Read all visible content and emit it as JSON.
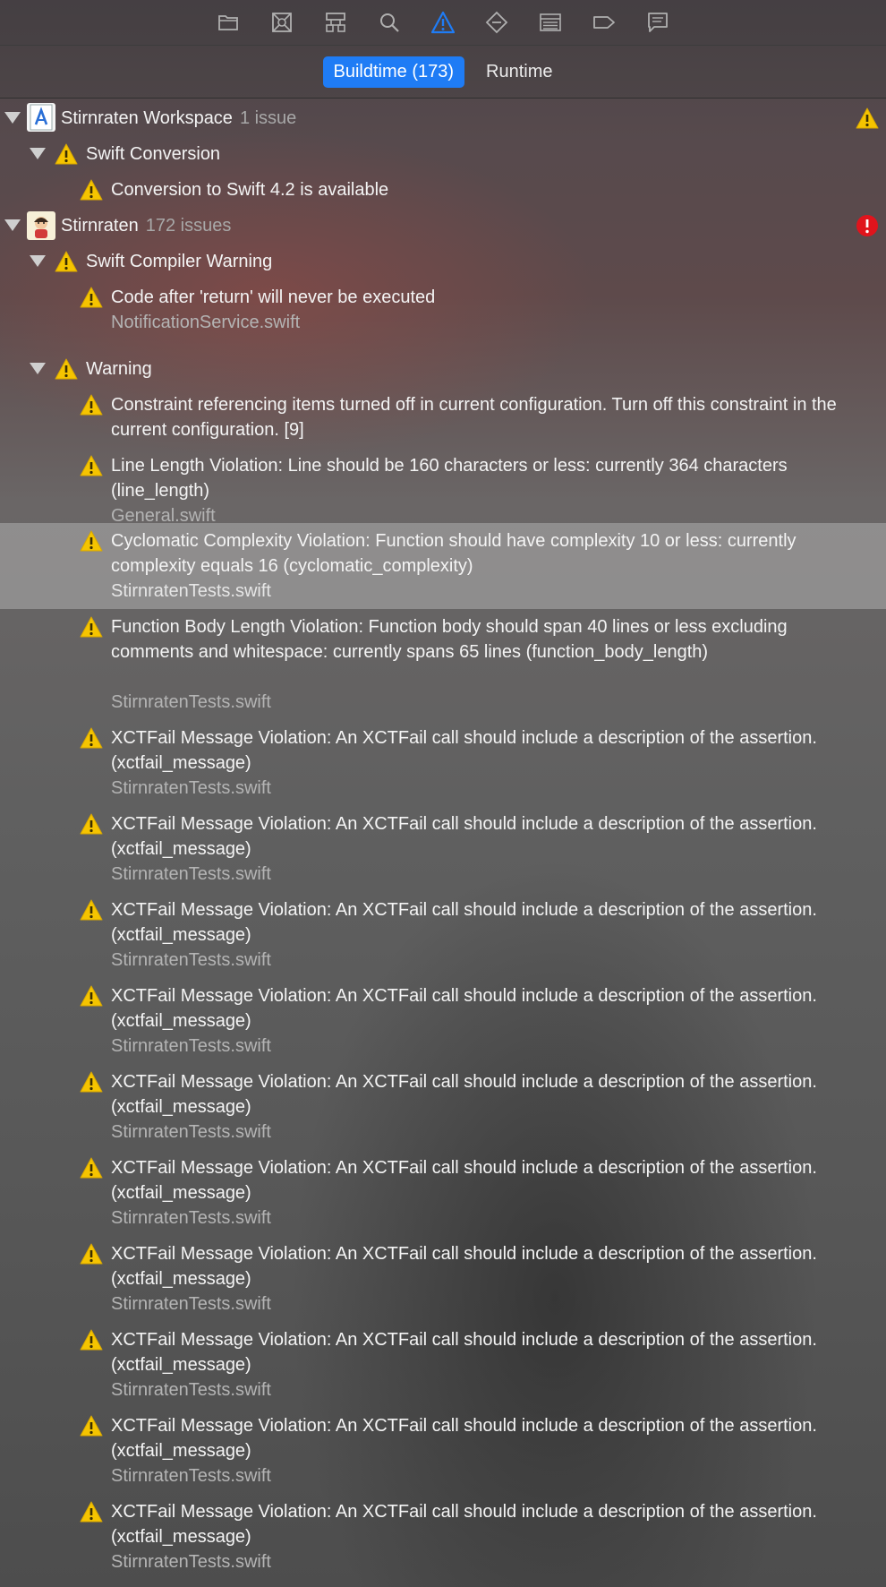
{
  "toolbar": {
    "icons": [
      "folder-icon",
      "source-control-icon",
      "hierarchy-icon",
      "search-icon",
      "warning-icon",
      "breakpoint-icon",
      "list-icon",
      "tag-icon",
      "comment-icon"
    ],
    "active_icon": "warning-icon",
    "accent_color": "#1f7cf5"
  },
  "scope": {
    "buildtime_label": "Buildtime (173)",
    "runtime_label": "Runtime",
    "selected": "Buildtime (173)"
  },
  "tree": {
    "workspace": {
      "name": "Stirnraten Workspace",
      "count": "1 issue"
    },
    "swift_conversion": {
      "label": "Swift Conversion"
    },
    "conversion_issue": {
      "message": "Conversion to Swift 4.2 is available"
    },
    "project": {
      "name": "Stirnraten",
      "count": "172 issues"
    },
    "compiler_warning": {
      "label": "Swift Compiler Warning"
    },
    "return_issue": {
      "message": "Code after 'return' will never be executed",
      "file": "NotificationService.swift"
    },
    "warning_group": {
      "label": "Warning"
    },
    "issues": [
      {
        "message": "Constraint referencing items turned off in current configuration. Turn off this constraint in the current configuration. [9]",
        "file": ""
      },
      {
        "message": "Line Length Violation: Line should be 160 characters or less: currently 364 characters (line_length)",
        "file": "General.swift"
      },
      {
        "message": "Cyclomatic Complexity Violation: Function should have complexity 10 or less: currently complexity equals 16 (cyclomatic_complexity)",
        "file": "StirnratenTests.swift",
        "selected": true
      },
      {
        "message": "Function Body Length Violation: Function body should span 40 lines or less excluding comments and whitespace: currently spans 65 lines (function_body_length)",
        "file": "StirnratenTests.swift"
      },
      {
        "message": "XCTFail Message Violation: An XCTFail call should include a description of the assertion. (xctfail_message)",
        "file": "StirnratenTests.swift"
      },
      {
        "message": "XCTFail Message Violation: An XCTFail call should include a description of the assertion. (xctfail_message)",
        "file": "StirnratenTests.swift"
      },
      {
        "message": "XCTFail Message Violation: An XCTFail call should include a description of the assertion. (xctfail_message)",
        "file": "StirnratenTests.swift"
      },
      {
        "message": "XCTFail Message Violation: An XCTFail call should include a description of the assertion. (xctfail_message)",
        "file": "StirnratenTests.swift"
      },
      {
        "message": "XCTFail Message Violation: An XCTFail call should include a description of the assertion. (xctfail_message)",
        "file": "StirnratenTests.swift"
      },
      {
        "message": "XCTFail Message Violation: An XCTFail call should include a description of the assertion. (xctfail_message)",
        "file": "StirnratenTests.swift"
      },
      {
        "message": "XCTFail Message Violation: An XCTFail call should include a description of the assertion. (xctfail_message)",
        "file": "StirnratenTests.swift"
      },
      {
        "message": "XCTFail Message Violation: An XCTFail call should include a description of the assertion. (xctfail_message)",
        "file": "StirnratenTests.swift"
      },
      {
        "message": "XCTFail Message Violation: An XCTFail call should include a description of the assertion. (xctfail_message)",
        "file": "StirnratenTests.swift"
      },
      {
        "message": "XCTFail Message Violation: An XCTFail call should include a description of the assertion. (xctfail_message)",
        "file": "StirnratenTests.swift"
      }
    ]
  },
  "colors": {
    "warning": "#f5c400",
    "error": "#e0141c"
  }
}
